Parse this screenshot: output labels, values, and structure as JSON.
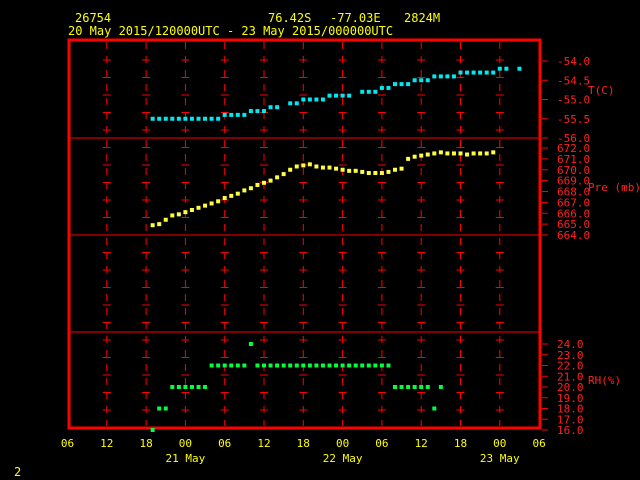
{
  "header": {
    "station": "26754",
    "lat": "76.42S",
    "lon": "-77.03E",
    "elev": "2824M",
    "period": "20 May 2015/120000UTC - 23 May 2015/000000UTC"
  },
  "footer_label": "2",
  "colors": {
    "frame": "#ff0000",
    "temp": "#00e8f0",
    "pres": "#ffff40",
    "rh": "#00ff40",
    "axis_text": "#ffff00",
    "scale_text": "#ff2020"
  },
  "chart_data": [
    {
      "type": "scatter",
      "name": "temperature",
      "ylabel": "T(C)",
      "yticks": [
        "-54.0",
        "-54.5",
        "-55.0",
        "-55.5",
        "-56.0"
      ],
      "ylim": [
        -56.0,
        -53.8
      ],
      "x_unit": "hours since 20 May 2015 06UTC",
      "points": [
        [
          13,
          -55.5
        ],
        [
          14,
          -55.5
        ],
        [
          15,
          -55.5
        ],
        [
          16,
          -55.5
        ],
        [
          17,
          -55.5
        ],
        [
          18,
          -55.5
        ],
        [
          19,
          -55.5
        ],
        [
          20,
          -55.5
        ],
        [
          21,
          -55.5
        ],
        [
          22,
          -55.5
        ],
        [
          23,
          -55.5
        ],
        [
          24,
          -55.4
        ],
        [
          25,
          -55.4
        ],
        [
          26,
          -55.4
        ],
        [
          27,
          -55.4
        ],
        [
          28,
          -55.3
        ],
        [
          29,
          -55.3
        ],
        [
          30,
          -55.3
        ],
        [
          31,
          -55.2
        ],
        [
          32,
          -55.2
        ],
        [
          34,
          -55.1
        ],
        [
          35,
          -55.1
        ],
        [
          36,
          -55.0
        ],
        [
          37,
          -55.0
        ],
        [
          38,
          -55.0
        ],
        [
          39,
          -55.0
        ],
        [
          40,
          -54.9
        ],
        [
          41,
          -54.9
        ],
        [
          42,
          -54.9
        ],
        [
          43,
          -54.9
        ],
        [
          45,
          -54.8
        ],
        [
          46,
          -54.8
        ],
        [
          47,
          -54.8
        ],
        [
          48,
          -54.7
        ],
        [
          49,
          -54.7
        ],
        [
          50,
          -54.6
        ],
        [
          51,
          -54.6
        ],
        [
          52,
          -54.6
        ],
        [
          53,
          -54.5
        ],
        [
          54,
          -54.5
        ],
        [
          55,
          -54.5
        ],
        [
          56,
          -54.4
        ],
        [
          57,
          -54.4
        ],
        [
          58,
          -54.4
        ],
        [
          59,
          -54.4
        ],
        [
          60,
          -54.3
        ],
        [
          61,
          -54.3
        ],
        [
          62,
          -54.3
        ],
        [
          63,
          -54.3
        ],
        [
          64,
          -54.3
        ],
        [
          65,
          -54.3
        ],
        [
          66,
          -54.2
        ],
        [
          67,
          -54.2
        ],
        [
          69,
          -54.2
        ]
      ]
    },
    {
      "type": "scatter",
      "name": "pressure",
      "ylabel": "Pre (mb)",
      "yticks": [
        "672.0",
        "671.0",
        "670.0",
        "669.0",
        "668.0",
        "667.0",
        "666.0",
        "665.0",
        "664.0"
      ],
      "ylim": [
        664.0,
        673.0
      ],
      "x_unit": "hours since 20 May 2015 06UTC",
      "points": [
        [
          13,
          664.9
        ],
        [
          14,
          665.0
        ],
        [
          15,
          665.4
        ],
        [
          16,
          665.8
        ],
        [
          17,
          665.9
        ],
        [
          18,
          666.1
        ],
        [
          19,
          666.3
        ],
        [
          20,
          666.5
        ],
        [
          21,
          666.7
        ],
        [
          22,
          666.9
        ],
        [
          23,
          667.1
        ],
        [
          24,
          667.4
        ],
        [
          25,
          667.6
        ],
        [
          26,
          667.8
        ],
        [
          27,
          668.1
        ],
        [
          28,
          668.3
        ],
        [
          29,
          668.6
        ],
        [
          30,
          668.8
        ],
        [
          31,
          669.0
        ],
        [
          32,
          669.3
        ],
        [
          33,
          669.6
        ],
        [
          34,
          670.0
        ],
        [
          35,
          670.3
        ],
        [
          36,
          670.4
        ],
        [
          37,
          670.5
        ],
        [
          38,
          670.3
        ],
        [
          39,
          670.2
        ],
        [
          40,
          670.2
        ],
        [
          41,
          670.1
        ],
        [
          42,
          670.0
        ],
        [
          43,
          669.9
        ],
        [
          44,
          669.9
        ],
        [
          45,
          669.8
        ],
        [
          46,
          669.7
        ],
        [
          47,
          669.7
        ],
        [
          48,
          669.7
        ],
        [
          49,
          669.8
        ],
        [
          50,
          670.0
        ],
        [
          51,
          670.1
        ],
        [
          52,
          671.0
        ],
        [
          53,
          671.2
        ],
        [
          54,
          671.3
        ],
        [
          55,
          671.4
        ],
        [
          56,
          671.5
        ],
        [
          57,
          671.6
        ],
        [
          58,
          671.5
        ],
        [
          59,
          671.5
        ],
        [
          60,
          671.5
        ],
        [
          61,
          671.4
        ],
        [
          62,
          671.5
        ],
        [
          63,
          671.5
        ],
        [
          64,
          671.5
        ],
        [
          65,
          671.6
        ]
      ]
    },
    {
      "type": "scatter",
      "name": "relative humidity",
      "ylabel": "RH(%)",
      "yticks": [
        "24.0",
        "23.0",
        "22.0",
        "21.0",
        "20.0",
        "19.0",
        "18.0",
        "17.0",
        "16.0"
      ],
      "ylim": [
        16.0,
        25.0
      ],
      "x_unit": "hours since 20 May 2015 06UTC",
      "points": [
        [
          13,
          16
        ],
        [
          14,
          18
        ],
        [
          15,
          18
        ],
        [
          16,
          20
        ],
        [
          17,
          20
        ],
        [
          18,
          20
        ],
        [
          19,
          20
        ],
        [
          20,
          20
        ],
        [
          21,
          20
        ],
        [
          22,
          22
        ],
        [
          23,
          22
        ],
        [
          24,
          22
        ],
        [
          25,
          22
        ],
        [
          26,
          22
        ],
        [
          27,
          22
        ],
        [
          28,
          24
        ],
        [
          29,
          22
        ],
        [
          30,
          22
        ],
        [
          31,
          22
        ],
        [
          32,
          22
        ],
        [
          33,
          22
        ],
        [
          34,
          22
        ],
        [
          35,
          22
        ],
        [
          36,
          22
        ],
        [
          37,
          22
        ],
        [
          38,
          22
        ],
        [
          39,
          22
        ],
        [
          40,
          22
        ],
        [
          41,
          22
        ],
        [
          42,
          22
        ],
        [
          43,
          22
        ],
        [
          44,
          22
        ],
        [
          45,
          22
        ],
        [
          46,
          22
        ],
        [
          47,
          22
        ],
        [
          48,
          22
        ],
        [
          49,
          22
        ],
        [
          50,
          20
        ],
        [
          51,
          20
        ],
        [
          52,
          20
        ],
        [
          53,
          20
        ],
        [
          54,
          20
        ],
        [
          55,
          20
        ],
        [
          56,
          18
        ],
        [
          57,
          20
        ]
      ]
    }
  ],
  "x_axis": {
    "hour_labels": [
      "06",
      "12",
      "18",
      "00",
      "06",
      "12",
      "18",
      "00",
      "06",
      "12",
      "18",
      "00",
      "06"
    ],
    "day_labels": [
      {
        "text": "21 May",
        "at_tick": 3
      },
      {
        "text": "22 May",
        "at_tick": 7
      },
      {
        "text": "23 May",
        "at_tick": 11
      }
    ]
  }
}
